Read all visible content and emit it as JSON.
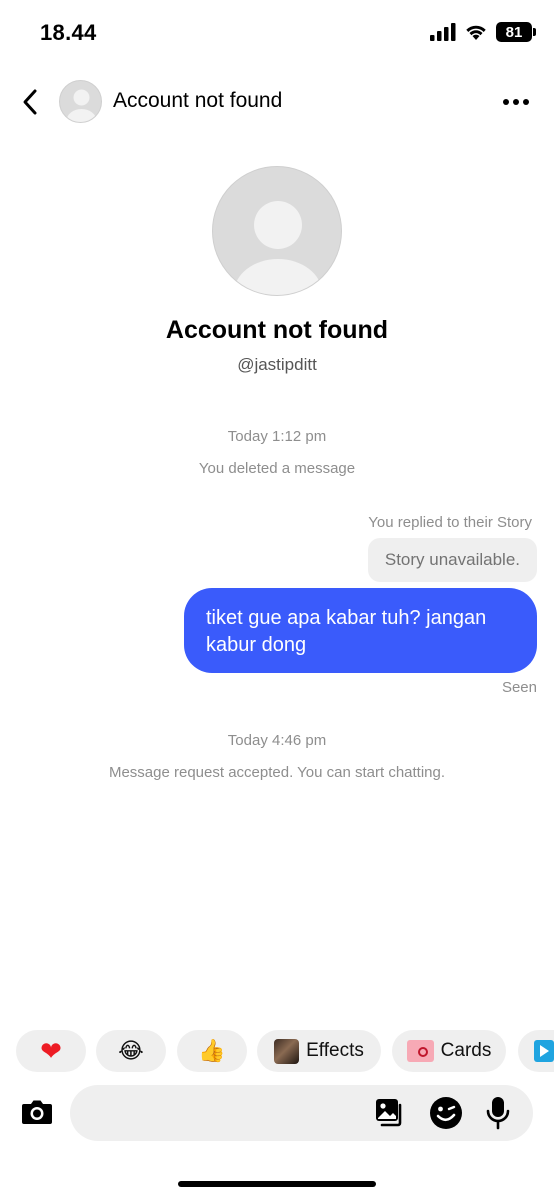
{
  "status_bar": {
    "time": "18.44",
    "battery": "81",
    "icons": [
      "signal-icon",
      "wifi-icon",
      "battery-icon"
    ]
  },
  "header": {
    "title": "Account not found",
    "back_icon": "chevron-left-icon",
    "more_icon": "more-horizontal-icon"
  },
  "profile": {
    "name": "Account not found",
    "handle": "@jastipditt"
  },
  "conversation": {
    "timestamp_1": "Today 1:12 pm",
    "deleted_notice": "You deleted a message",
    "reply_label": "You replied to their Story",
    "story_unavailable": "Story unavailable.",
    "sent_message": "tiket gue apa kabar tuh? jangan kabur dong",
    "seen": "Seen",
    "timestamp_2": "Today 4:46 pm",
    "accepted_notice": "Message request accepted. You can start chatting."
  },
  "quick_actions": {
    "reactions": [
      "❤",
      "😂",
      "👍"
    ],
    "effects_label": "Effects",
    "cards_label": "Cards"
  },
  "composer": {
    "placeholder": "",
    "icons": [
      "camera-icon",
      "gallery-icon",
      "sticker-icon",
      "microphone-icon"
    ]
  },
  "colors": {
    "accent_bubble": "#3a5bfb",
    "meta_text": "#8e8e8e",
    "chip_background": "#efefef",
    "heart": "#ed1c24"
  }
}
